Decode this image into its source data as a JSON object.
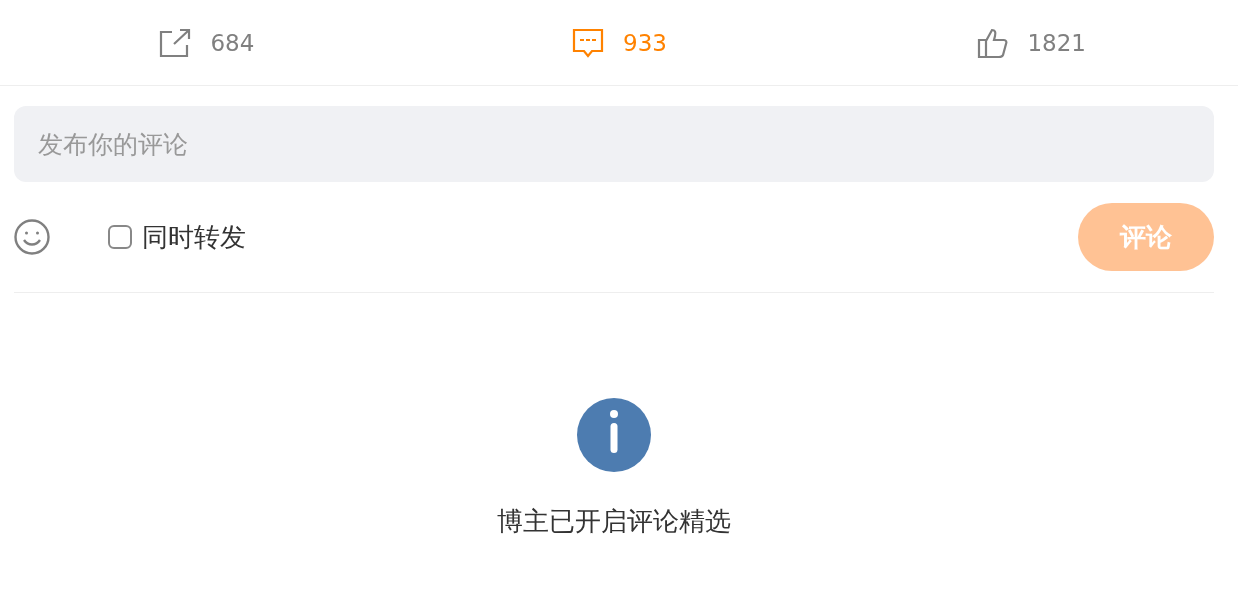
{
  "actions": [
    {
      "kind": "share",
      "count": "684",
      "selected": false
    },
    {
      "kind": "comment",
      "count": "933",
      "selected": true
    },
    {
      "kind": "like",
      "count": "1821",
      "selected": false
    }
  ],
  "comment_box": {
    "placeholder": "发布你的评论"
  },
  "repost_option": {
    "label": "同时转发",
    "checked": false
  },
  "submit_button": {
    "label": "评论",
    "disabled": true
  },
  "notice": {
    "text": "博主已开启评论精选"
  }
}
